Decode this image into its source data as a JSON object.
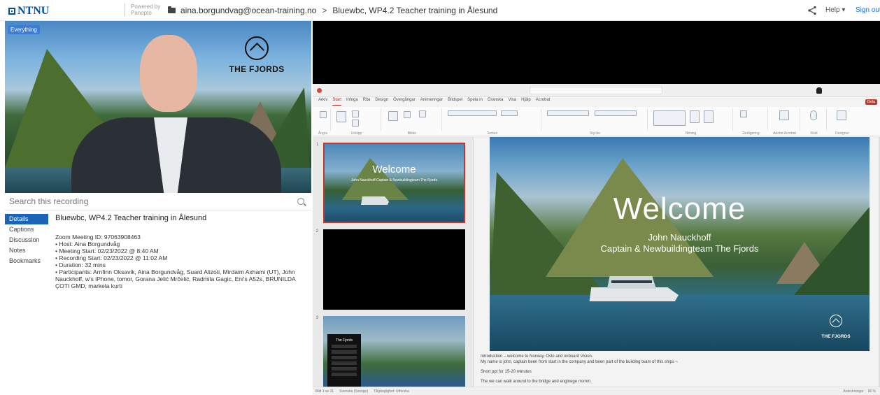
{
  "header": {
    "logo": "NTNU",
    "powered_by": "Powered by",
    "powered_by_brand": "Panopto",
    "folder": "aina.borgundvag@ocean-training.no",
    "separator": ">",
    "session_title": "Bluewbc, WP4.2 Teacher training in Ålesund",
    "help": "Help ▾",
    "sign_out": "Sign out"
  },
  "video": {
    "badge": "Everything",
    "logo_text": "THE FJORDS"
  },
  "search": {
    "placeholder": "Search this recording"
  },
  "tabs": [
    "Details",
    "Captions",
    "Discussion",
    "Notes",
    "Bookmarks"
  ],
  "details": {
    "title": "Bluewbc, WP4.2 Teacher training in Ålesund",
    "meeting_id": "Zoom Meeting ID: 97063908463",
    "host": "• Host: Aina Borgundvåg",
    "meeting_start": "• Meeting Start: 02/23/2022 @ 8:40 AM",
    "recording_start": "• Recording Start: 02/23/2022 @ 11:02 AM",
    "duration": "• Duration: 32 mins",
    "participants": "• Participants: Arnfinn Oksavik, Aina Borgundvåg, Suard Alizoti, Mirdaim Axhami (UT), John Nauckhoff, w's iPhone, tomor, Gorana Jelić Mrčelić, Radmila Gagic, Eni's A52s, BRUNILDA ÇOTI GMD, markela kurti"
  },
  "ppt": {
    "ribbon_tabs": [
      "Arkiv",
      "Start",
      "Infoga",
      "Rita",
      "Design",
      "Övergångar",
      "Animeringar",
      "Bildspel",
      "Spela in",
      "Granska",
      "Visa",
      "Hjälp",
      "Acrobat"
    ],
    "active_tab": "Start",
    "share": "Dela",
    "ribbon_groups": [
      "Ångra",
      "Urklipp",
      "Bilder",
      "Tecken",
      "Stycke",
      "Ritning",
      "Redigering",
      "Adobe Acrobat",
      "Röst",
      "Designer"
    ],
    "slide_numbers": [
      "1",
      "2",
      "3"
    ],
    "thumb1_title": "Welcome",
    "thumb1_sub": "John Nauckhoff Captain & Newbuildingteam The Fjords",
    "thumb3_title": "The Fjords",
    "slide": {
      "title": "Welcome",
      "subtitle1": "John Nauckhoff",
      "subtitle2": "Captain & Newbuildingteam The Fjords",
      "logo": "THE FJORDS"
    },
    "notes": {
      "line1": "Introduction – welcome to Norway, Oslo and onboard Vision.",
      "line2": "My name is john, captain been from start in the company and been part of the building team of this ships –",
      "line3": "Short ppt for 15-20 minutes",
      "line4": "The we can walk around to the bridge and enginege rromm."
    },
    "status": {
      "slide": "Bild 1 av 31",
      "language": "Svenska (Sverige)",
      "accessibility": "Tillgänglighet: Utforska",
      "notes_btn": "Anteckningar",
      "zoom": "96 %"
    }
  }
}
